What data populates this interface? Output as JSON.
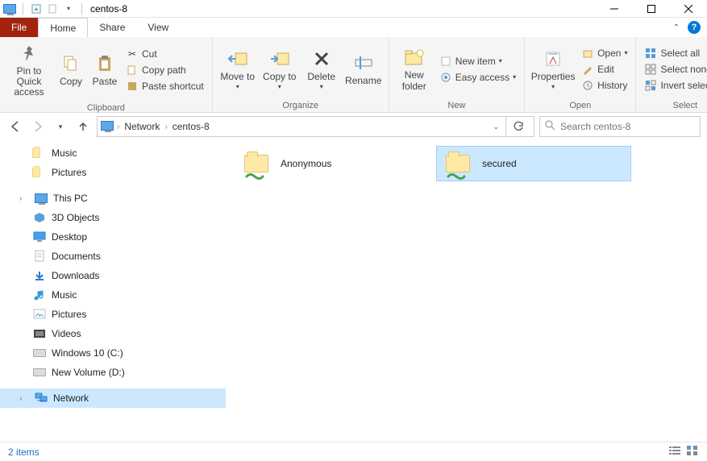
{
  "window": {
    "title": "centos-8"
  },
  "tabs": {
    "file": "File",
    "home": "Home",
    "share": "Share",
    "view": "View"
  },
  "ribbon": {
    "pin": "Pin to Quick access",
    "copy": "Copy",
    "paste": "Paste",
    "cut": "Cut",
    "copy_path": "Copy path",
    "paste_shortcut": "Paste shortcut",
    "clipboard_label": "Clipboard",
    "move_to": "Move to",
    "copy_to": "Copy to",
    "delete": "Delete",
    "rename": "Rename",
    "organize_label": "Organize",
    "new_folder": "New folder",
    "new_item": "New item",
    "easy_access": "Easy access",
    "new_label": "New",
    "properties": "Properties",
    "open": "Open",
    "edit": "Edit",
    "history": "History",
    "open_label": "Open",
    "select_all": "Select all",
    "select_none": "Select none",
    "invert": "Invert selection",
    "select_label": "Select"
  },
  "breadcrumb": {
    "root": "Network",
    "current": "centos-8"
  },
  "search": {
    "placeholder": "Search centos-8"
  },
  "tree": {
    "music": "Music",
    "pictures": "Pictures",
    "this_pc": "This PC",
    "objects_3d": "3D Objects",
    "desktop": "Desktop",
    "documents": "Documents",
    "downloads": "Downloads",
    "music2": "Music",
    "pictures2": "Pictures",
    "videos": "Videos",
    "drive_c": "Windows 10 (C:)",
    "drive_d": "New Volume (D:)",
    "network": "Network"
  },
  "items": [
    {
      "name": "Anonymous",
      "selected": false
    },
    {
      "name": "secured",
      "selected": true
    }
  ],
  "status": {
    "count": "2 items"
  }
}
